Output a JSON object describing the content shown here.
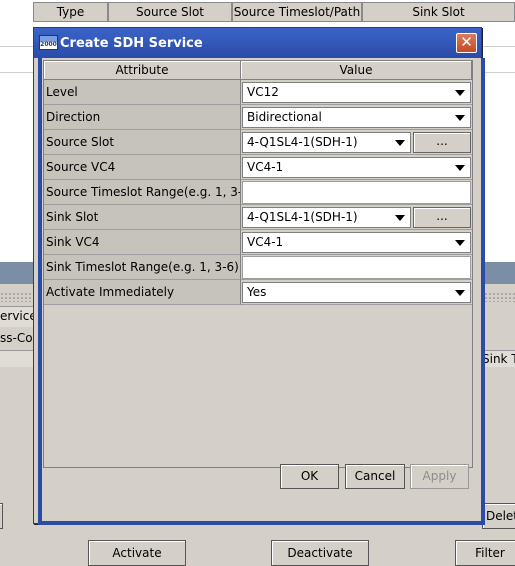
{
  "background": {
    "table_headers": [
      "Type",
      "Source Slot",
      "Source Timeslot/Path",
      "Sink Slot"
    ],
    "left_labels": [
      "ervices",
      "ss-Co"
    ],
    "right_label": "Sink T",
    "buttons": [
      "Activate",
      "Deactivate",
      "Filter",
      "Delet"
    ]
  },
  "dialog": {
    "title": "Create SDH Service",
    "icon_text": "2000",
    "close_glyph": "✕",
    "columns": {
      "attribute": "Attribute",
      "value": "Value"
    },
    "rows": [
      {
        "label": "Level",
        "kind": "combo",
        "value": "VC12"
      },
      {
        "label": "Direction",
        "kind": "combo",
        "value": "Bidirectional"
      },
      {
        "label": "Source Slot",
        "kind": "combo-browse",
        "value": "4-Q1SL4-1(SDH-1)",
        "browse": "..."
      },
      {
        "label": "Source VC4",
        "kind": "combo",
        "value": "VC4-1"
      },
      {
        "label": "Source Timeslot Range(e.g. 1, 3-...",
        "kind": "text",
        "value": ""
      },
      {
        "label": "Sink Slot",
        "kind": "combo-browse",
        "value": "4-Q1SL4-1(SDH-1)",
        "browse": "..."
      },
      {
        "label": "Sink VC4",
        "kind": "combo",
        "value": "VC4-1"
      },
      {
        "label": "Sink Timeslot Range(e.g. 1, 3-6)",
        "kind": "text",
        "value": ""
      },
      {
        "label": "Activate Immediately",
        "kind": "combo",
        "value": "Yes"
      }
    ],
    "buttons": {
      "ok": "OK",
      "cancel": "Cancel",
      "apply": "Apply"
    }
  },
  "colors": {
    "title_bar": "#2a4ba8",
    "close_button": "#c24a28",
    "band": "#7b8ea6"
  }
}
